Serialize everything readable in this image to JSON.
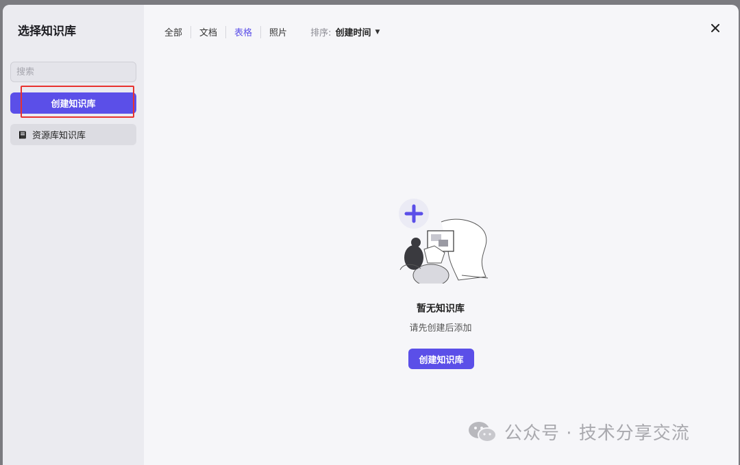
{
  "sidebar": {
    "title": "选择知识库",
    "search_placeholder": "搜索",
    "create_label": "创建知识库",
    "items": [
      {
        "label": "资源库知识库",
        "icon": "book-icon"
      }
    ]
  },
  "tabs": [
    {
      "label": "全部",
      "active": false
    },
    {
      "label": "文档",
      "active": false
    },
    {
      "label": "表格",
      "active": true
    },
    {
      "label": "照片",
      "active": false
    }
  ],
  "sort": {
    "label": "排序:",
    "value": "创建时间"
  },
  "empty": {
    "title": "暂无知识库",
    "subtitle": "请先创建后添加",
    "button_label": "创建知识库"
  },
  "watermark": {
    "text": "公众号 · 技术分享交流"
  },
  "colors": {
    "accent": "#5b4fe8",
    "highlight": "#e8322f",
    "sidebar": "#ebebf0",
    "main": "#f6f6f9"
  }
}
